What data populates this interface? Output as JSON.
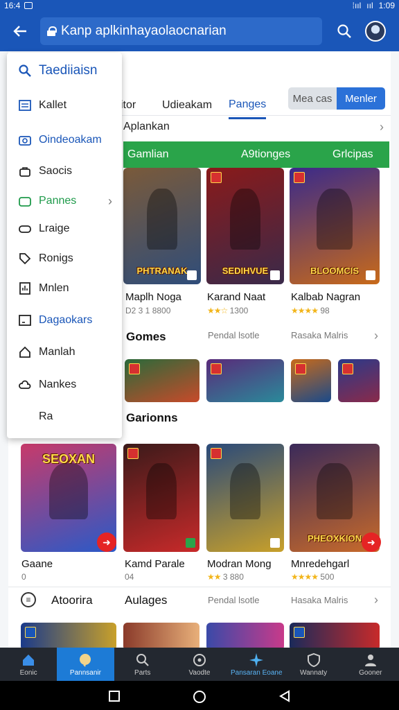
{
  "status_bar": {
    "time": "16:4",
    "right_time": "1:09"
  },
  "app_bar": {
    "url": "Kanp aplkinhayaolaocnarian"
  },
  "tabs": [
    {
      "label": "itor"
    },
    {
      "label": "Udieakam"
    },
    {
      "label": "Panges",
      "active": true
    }
  ],
  "segment": {
    "left": "Mea cas",
    "right": "Menler"
  },
  "drawer": {
    "header": "Taediiaisn",
    "items": [
      {
        "label": "Kallet",
        "icon": "list-icon"
      },
      {
        "label": "Oindeoakam",
        "icon": "camera-icon",
        "color": "blue"
      },
      {
        "label": "Saocis",
        "icon": "bag-icon"
      },
      {
        "label": "Pannes",
        "icon": "folder-icon",
        "color": "green",
        "has_chevron": true
      },
      {
        "label": "Lraige",
        "icon": "gamepad-icon"
      },
      {
        "label": "Ronigs",
        "icon": "tag-icon"
      },
      {
        "label": "Mnlen",
        "icon": "chart-icon"
      },
      {
        "label": "Dagaokars",
        "icon": "calendar-icon",
        "color": "blue"
      },
      {
        "label": "Manlah",
        "icon": "home-outline-icon"
      },
      {
        "label": "Nankes",
        "icon": "cloud-icon"
      },
      {
        "label": "Ra"
      }
    ]
  },
  "section1": {
    "header": "Aplankan",
    "green_bar": [
      "Gamlian",
      "A9tionges",
      "Grlcipas"
    ]
  },
  "featured_games": [
    {
      "art_title": "PHTRANAK",
      "name": "Maplh Noga",
      "meta": "D2 3  1 8800",
      "colors": [
        "#7a5a3a",
        "#2f4d7a"
      ]
    },
    {
      "art_title": "SEDIHVUE",
      "name": "Karand Naat",
      "meta": "1300",
      "stars": "★★☆",
      "colors": [
        "#8a1a1a",
        "#3a2a4a"
      ]
    },
    {
      "art_title": "BLOOMCIS",
      "name": "Kalbab Nagran",
      "meta": "98",
      "stars": "★★★★",
      "colors": [
        "#3a2a8a",
        "#c86a1a"
      ]
    }
  ],
  "games_row": {
    "title": "Gomes",
    "mid": "Pendal lsotle",
    "right": "Rasaka Malris"
  },
  "small_games": [
    {
      "colors": [
        "#2a6a3a",
        "#c84a2a"
      ]
    },
    {
      "colors": [
        "#5a2a7a",
        "#2a8a9a"
      ]
    },
    {
      "colors": [
        "#c86a1a",
        "#1a4a8a"
      ]
    },
    {
      "colors": [
        "#2a3a8a",
        "#8a2a4a"
      ]
    }
  ],
  "section2": {
    "title": "Garionns"
  },
  "main_games": [
    {
      "art_title": "SEOXAN",
      "name": "Gaane",
      "meta": "0",
      "colors": [
        "#c83a6a",
        "#2a5ac8"
      ],
      "has_play": true
    },
    {
      "name": "Kamd Parale",
      "meta": "04",
      "colors": [
        "#3a1a1a",
        "#c82a2a"
      ]
    },
    {
      "name": "Modran Mong",
      "meta": "3  880",
      "stars": "★★",
      "colors": [
        "#2a4a7a",
        "#c8a02a"
      ]
    },
    {
      "art_title": "PHEOXKION",
      "name": "Mnredehgarl",
      "meta": "500",
      "stars": "★★★★",
      "colors": [
        "#3a2a5a",
        "#c86a2a"
      ],
      "has_play": true
    }
  ],
  "footer_row": {
    "icon_label": "Atoorira",
    "title": "Aulages",
    "mid": "Pendal lsotle",
    "right": "Hasaka Malris"
  },
  "bottom_nav": [
    {
      "label": "Eonic",
      "icon": "home-icon"
    },
    {
      "label": "Pannsanir",
      "icon": "chat-icon",
      "active": true
    },
    {
      "label": "Parts",
      "icon": "search-icon"
    },
    {
      "label": "Vaodte",
      "icon": "disc-icon"
    },
    {
      "label": "Pansaran Eoane",
      "icon": "sparkle-icon"
    },
    {
      "label": "Wannaty",
      "icon": "shield-icon"
    },
    {
      "label": "Gooner",
      "icon": "person-icon"
    }
  ]
}
